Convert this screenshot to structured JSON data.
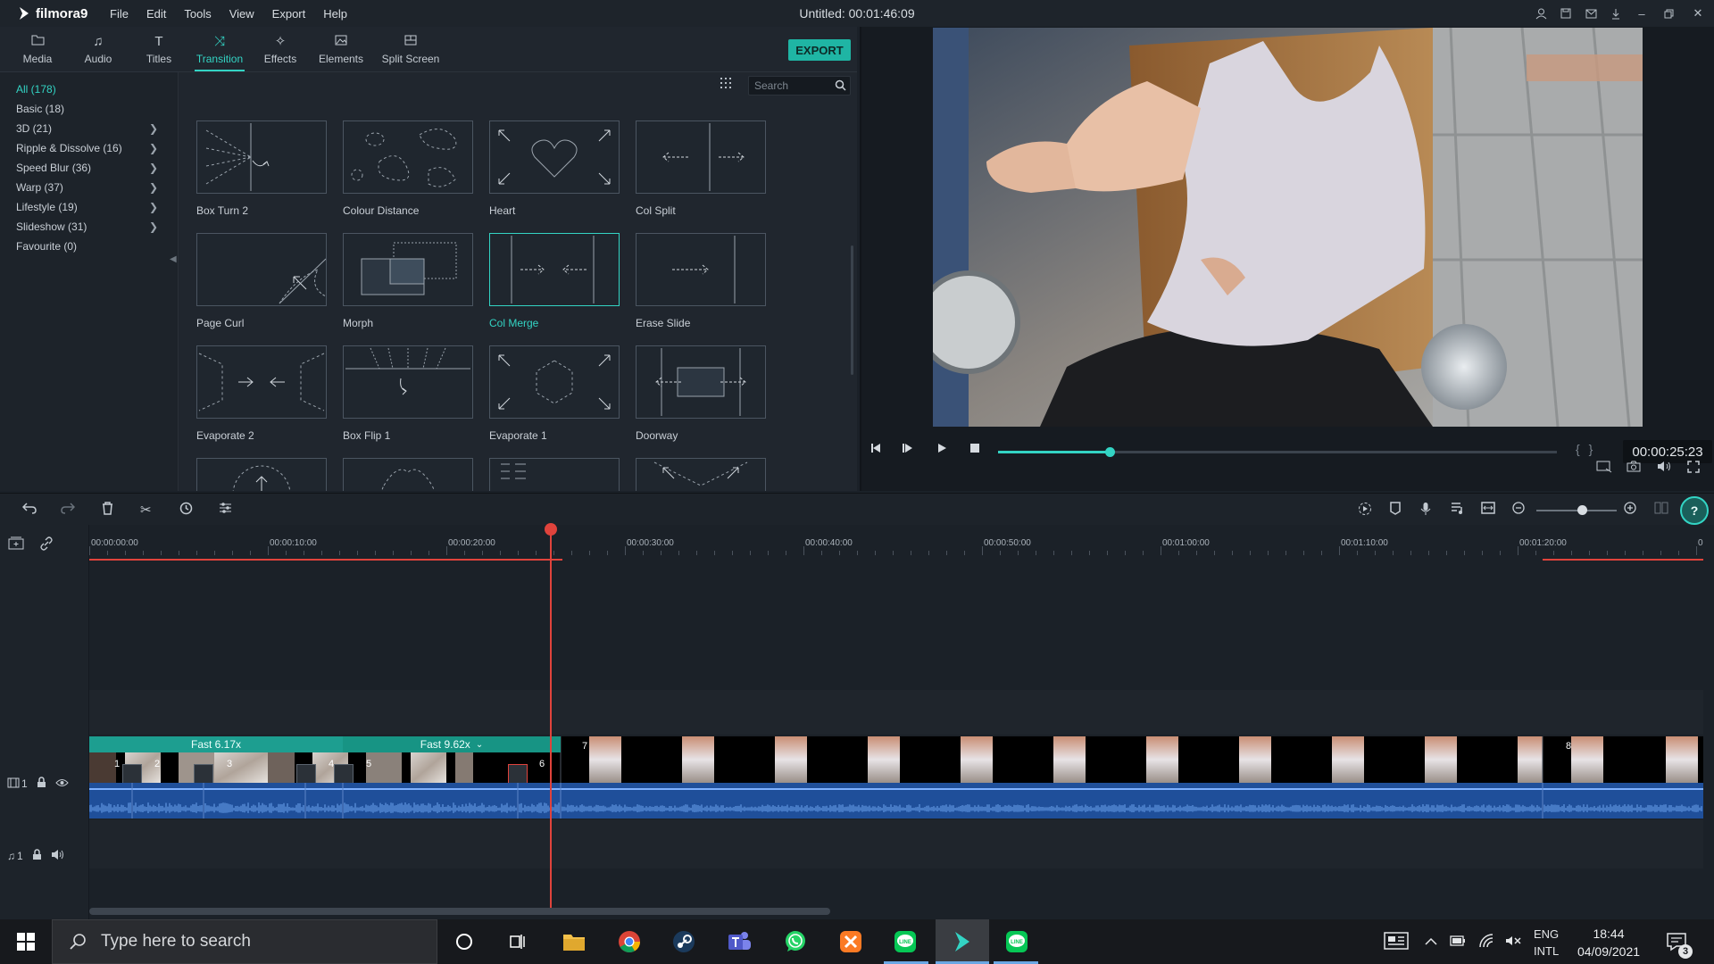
{
  "app": {
    "name": "filmora9",
    "window_title": "Untitled:",
    "project_time": "00:01:46:09",
    "menu": [
      "File",
      "Edit",
      "Tools",
      "View",
      "Export",
      "Help"
    ]
  },
  "tabs": [
    {
      "label": "Media",
      "icon": "folder-icon"
    },
    {
      "label": "Audio",
      "icon": "music-note-icon"
    },
    {
      "label": "Titles",
      "icon": "text-icon"
    },
    {
      "label": "Transition",
      "icon": "transition-icon",
      "active": true
    },
    {
      "label": "Effects",
      "icon": "effects-icon"
    },
    {
      "label": "Elements",
      "icon": "image-icon"
    },
    {
      "label": "Split Screen",
      "icon": "split-screen-icon"
    }
  ],
  "export_label": "EXPORT",
  "search_placeholder": "Search",
  "categories": [
    {
      "label": "All (178)",
      "active": true,
      "arrow": false
    },
    {
      "label": "Basic (18)",
      "arrow": false
    },
    {
      "label": "3D (21)",
      "arrow": true
    },
    {
      "label": "Ripple & Dissolve (16)",
      "arrow": true
    },
    {
      "label": "Speed Blur (36)",
      "arrow": true
    },
    {
      "label": "Warp (37)",
      "arrow": true
    },
    {
      "label": "Lifestyle (19)",
      "arrow": true
    },
    {
      "label": "Slideshow (31)",
      "arrow": true
    },
    {
      "label": "Favourite (0)",
      "arrow": false
    }
  ],
  "transitions": [
    {
      "label": "Box Turn 2"
    },
    {
      "label": "Colour Distance"
    },
    {
      "label": "Heart"
    },
    {
      "label": "Col Split"
    },
    {
      "label": "Page Curl"
    },
    {
      "label": "Morph"
    },
    {
      "label": "Col Merge",
      "selected": true
    },
    {
      "label": "Erase Slide"
    },
    {
      "label": "Evaporate 2"
    },
    {
      "label": "Box Flip 1"
    },
    {
      "label": "Evaporate 1"
    },
    {
      "label": "Doorway"
    },
    {
      "label": ""
    },
    {
      "label": ""
    },
    {
      "label": ""
    },
    {
      "label": ""
    }
  ],
  "preview": {
    "timecode": "00:00:25:23",
    "playback_progress": 0.2
  },
  "timeline": {
    "ruler_labels": [
      "00:00:00:00",
      "00:00:10:00",
      "00:00:20:00",
      "00:00:30:00",
      "00:00:40:00",
      "00:00:50:00",
      "00:01:00:00",
      "00:01:10:00",
      "00:01:20:00",
      "0"
    ],
    "speed_labels": [
      "Fast 6.17x",
      "Fast 9.62x"
    ],
    "clip_numbers": [
      "1",
      "2",
      "3",
      "4",
      "5",
      "6",
      "7",
      "8"
    ],
    "video_track_label": "1",
    "audio_track_label": "1"
  },
  "taskbar": {
    "search_placeholder": "Type here to search",
    "lang_top": "ENG",
    "lang_bottom": "INTL",
    "time": "18:44",
    "date": "04/09/2021",
    "notification_count": "3",
    "apps": [
      "task-view-icon",
      "file-explorer-icon",
      "chrome-icon",
      "steam-icon",
      "teams-icon",
      "whatsapp-icon",
      "xampp-icon",
      "line-icon",
      "filmora-icon",
      "line-icon"
    ]
  },
  "colors": {
    "accent": "#33d4c4",
    "playhead": "#e0433c",
    "audio_track": "#1f4f9a",
    "speed_bar": "#1d9e90"
  }
}
